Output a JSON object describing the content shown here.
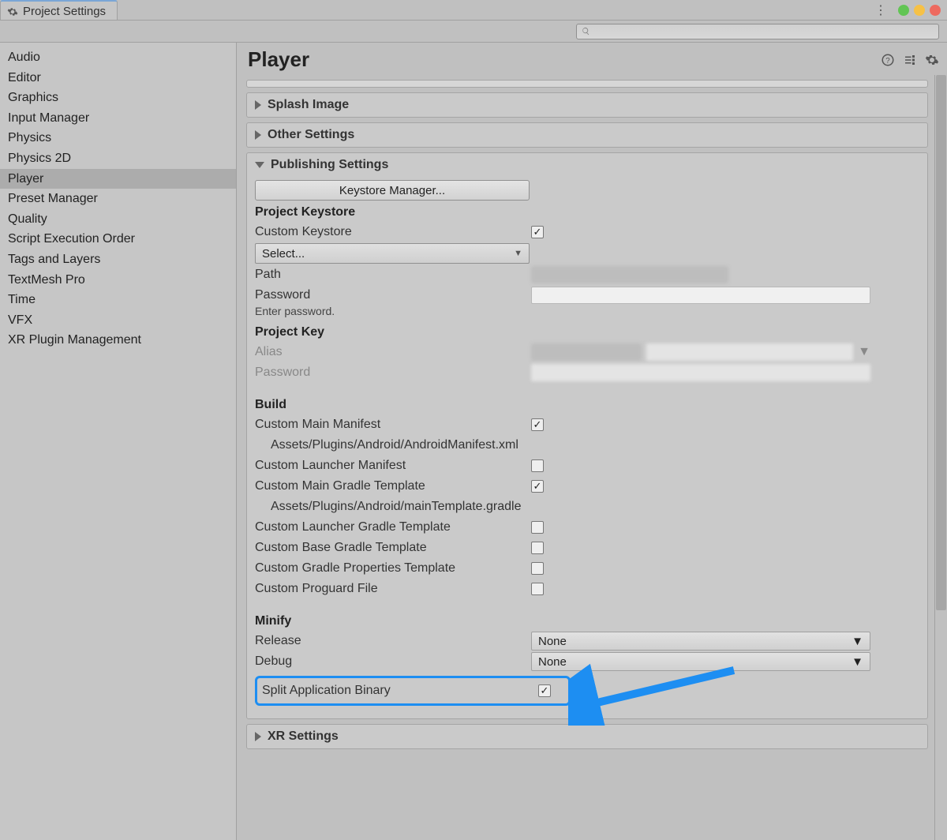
{
  "window": {
    "tab_title": "Project Settings"
  },
  "sidebar": {
    "items": [
      "Audio",
      "Editor",
      "Graphics",
      "Input Manager",
      "Physics",
      "Physics 2D",
      "Player",
      "Preset Manager",
      "Quality",
      "Script Execution Order",
      "Tags and Layers",
      "TextMesh Pro",
      "Time",
      "VFX",
      "XR Plugin Management"
    ],
    "selected_index": 6
  },
  "main": {
    "title": "Player",
    "splash_image": {
      "label": "Splash Image"
    },
    "other_settings": {
      "label": "Other Settings"
    },
    "publishing": {
      "label": "Publishing Settings",
      "keystore_manager_button": "Keystore Manager...",
      "project_keystore_title": "Project Keystore",
      "custom_keystore_label": "Custom Keystore",
      "custom_keystore_checked": true,
      "keystore_select": "Select...",
      "path_label": "Path",
      "password_label": "Password",
      "password_helper": "Enter password.",
      "project_key_title": "Project Key",
      "alias_label": "Alias",
      "pk_password_label": "Password",
      "build_title": "Build",
      "build_rows": [
        {
          "label": "Custom Main Manifest",
          "checked": true,
          "path": "Assets/Plugins/Android/AndroidManifest.xml"
        },
        {
          "label": "Custom Launcher Manifest",
          "checked": false
        },
        {
          "label": "Custom Main Gradle Template",
          "checked": true,
          "path": "Assets/Plugins/Android/mainTemplate.gradle"
        },
        {
          "label": "Custom Launcher Gradle Template",
          "checked": false
        },
        {
          "label": "Custom Base Gradle Template",
          "checked": false
        },
        {
          "label": "Custom Gradle Properties Template",
          "checked": false
        },
        {
          "label": "Custom Proguard File",
          "checked": false
        }
      ],
      "minify_title": "Minify",
      "minify_release_label": "Release",
      "minify_release_value": "None",
      "minify_debug_label": "Debug",
      "minify_debug_value": "None",
      "split_binary_label": "Split Application Binary",
      "split_binary_checked": true
    },
    "xr_settings": {
      "label": "XR Settings"
    }
  }
}
